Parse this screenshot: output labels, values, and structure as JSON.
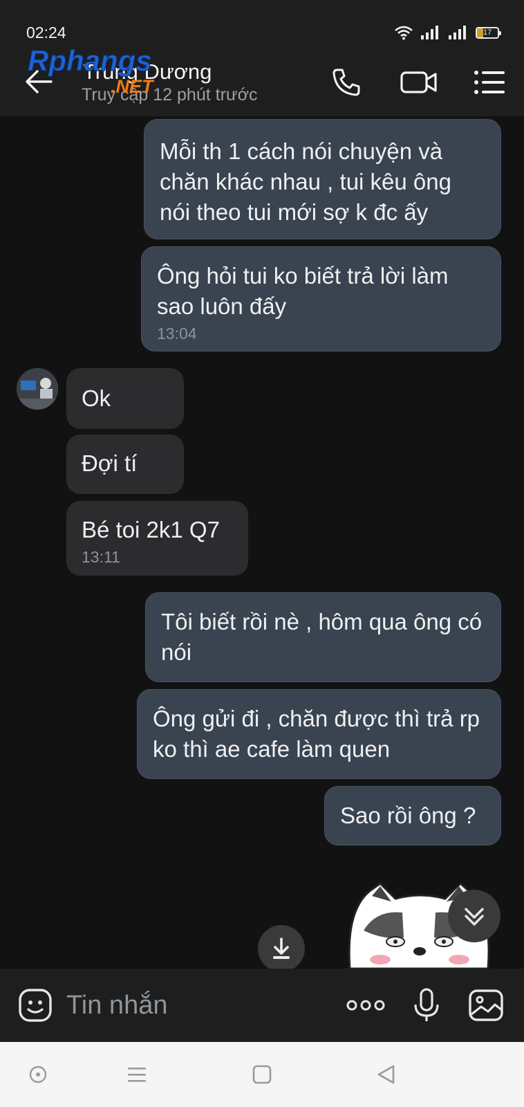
{
  "status_bar": {
    "time": "02:24",
    "battery": "17",
    "icons": [
      "wifi-icon",
      "signal-icon",
      "signal-icon",
      "battery-icon"
    ]
  },
  "header": {
    "contact_name": "Trung Dương",
    "last_seen": "Truy cập 12 phút trước",
    "watermark_line1": "Rphangs",
    "watermark_line2": ".NET",
    "icons": [
      "back-arrow-icon",
      "phone-icon",
      "video-call-icon",
      "menu-icon"
    ]
  },
  "messages": [
    {
      "direction": "out",
      "text": "Mỗi th 1 cách nói chuyện và chăn khác nhau , tui kêu ông nói theo tui mới sợ k đc ấy",
      "time": ""
    },
    {
      "direction": "out",
      "text": "Ông hỏi tui ko biết trả lời làm sao luôn đấy",
      "time": "13:04"
    },
    {
      "direction": "in",
      "text": "Ok",
      "time": ""
    },
    {
      "direction": "in",
      "text": "Đợi tí",
      "time": ""
    },
    {
      "direction": "in",
      "text": "Bé toi 2k1 Q7",
      "time": "13:11"
    },
    {
      "direction": "out",
      "text": "Tôi biết rồi nè , hôm qua ông có nói",
      "time": ""
    },
    {
      "direction": "out",
      "text": "Ông gửi đi , chăn được thì trả rp ko thì ae cafe làm quen",
      "time": ""
    },
    {
      "direction": "out",
      "text": "Sao rồi ông ?",
      "time": ""
    }
  ],
  "composer": {
    "placeholder": "Tin nhắn",
    "icons": [
      "emoji-icon",
      "more-dots-icon",
      "microphone-icon",
      "image-icon"
    ]
  },
  "floating": {
    "icons": [
      "download-icon",
      "chevron-double-down-icon"
    ],
    "sticker": "husky-sticker"
  },
  "navbar": {
    "icons": [
      "recent-apps-dot-icon",
      "menu-lines-icon",
      "home-square-icon",
      "back-triangle-icon"
    ]
  },
  "colors": {
    "background": "#121212",
    "header": "#1e1e1e",
    "outgoing_bubble": "#3a4350",
    "incoming_bubble": "#2c2c2e",
    "time_text": "#8c939c",
    "navbar": "#f5f5f5"
  }
}
